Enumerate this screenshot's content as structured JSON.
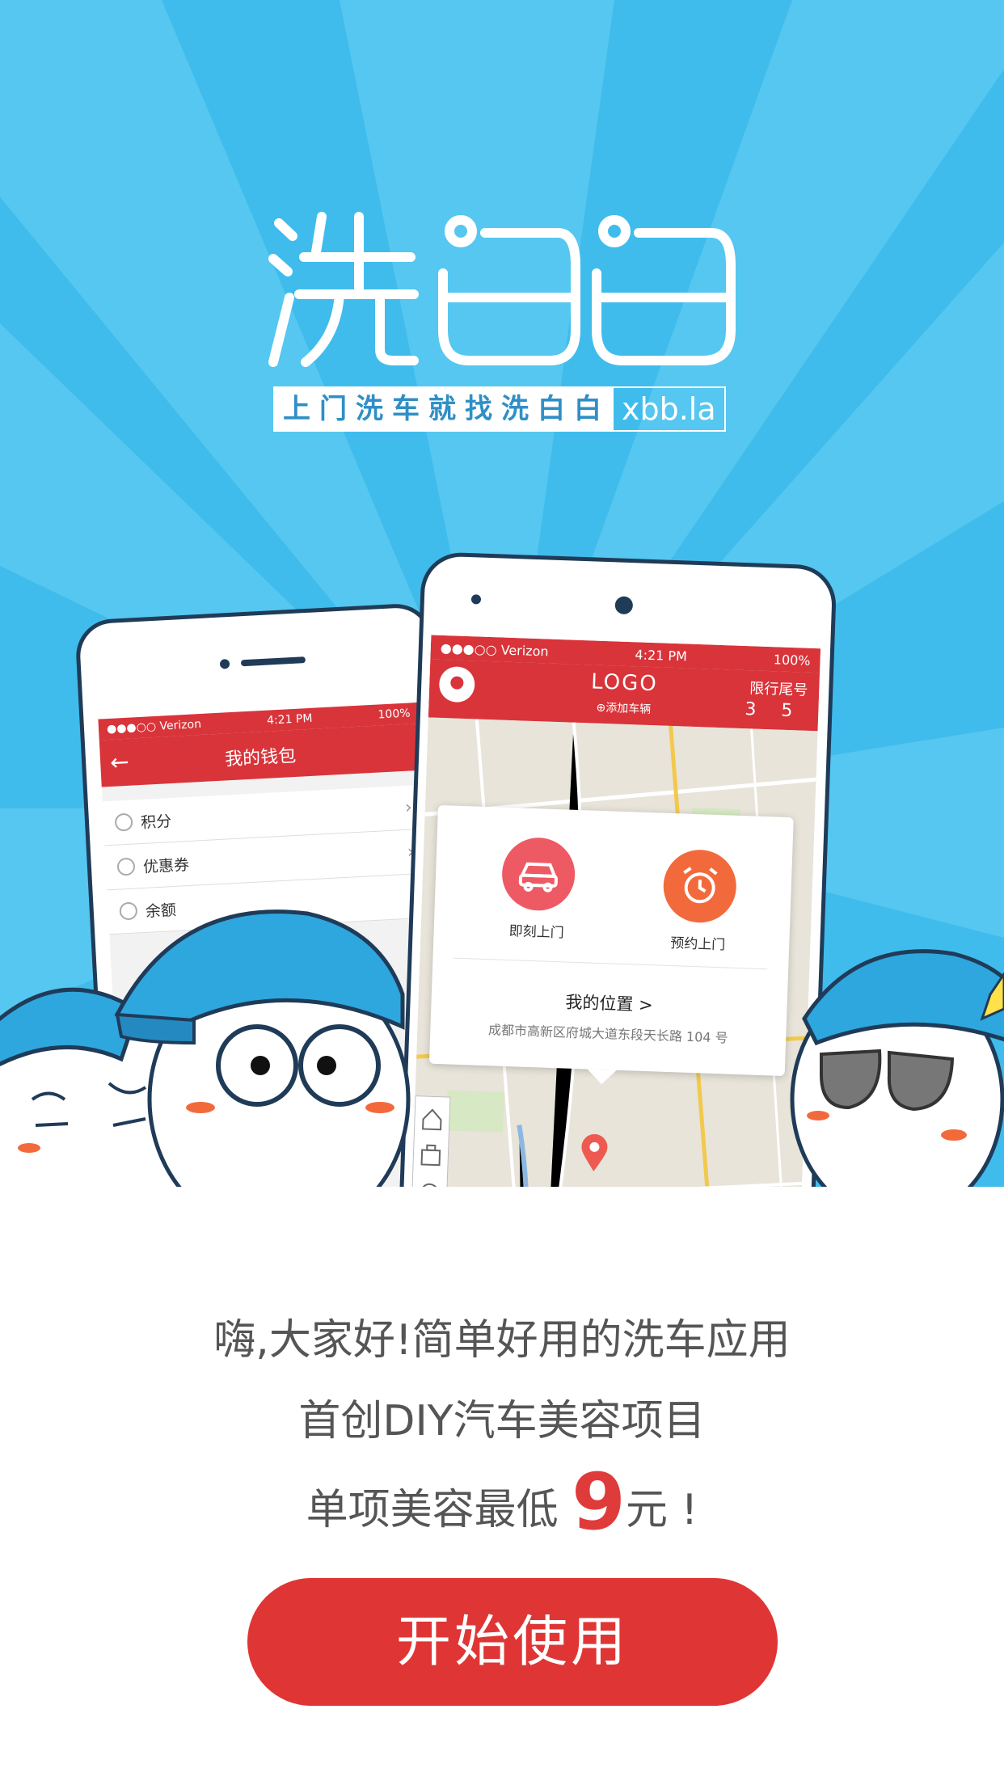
{
  "brand": {
    "logo_text": "洗白白",
    "tagline": "上门洗车就找洗白白",
    "url": "xbb.la"
  },
  "wallet_phone": {
    "carrier": "●●●○○ Verizon",
    "time": "4:21 PM",
    "battery": "100%",
    "title": "我的钱包",
    "rows": [
      {
        "label": "积分"
      },
      {
        "label": "优惠券"
      },
      {
        "label": "余额"
      }
    ]
  },
  "map_phone": {
    "carrier": "●●●○○ Verizon",
    "time": "4:21 PM",
    "battery": "100%",
    "logo": "LOGO",
    "add_car": "⊕添加车辆",
    "limit_label": "限行尾号",
    "limit_numbers": "3 5",
    "now_label": "即刻上门",
    "book_label": "预约上门",
    "location_title": "我的位置  >",
    "address": "成都市高新区府城大道东段天长路 104 号"
  },
  "copy": {
    "line1": "嗨,大家好!简单好用的洗车应用",
    "line2": "首创DIY汽车美容项目",
    "line3_pre": "单项美容最低 ",
    "price": "9",
    "line3_post": "元 !"
  },
  "cta": {
    "label": "开始使用"
  },
  "colors": {
    "sky": "#3fbcec",
    "red": "#e03535",
    "navy": "#1f3b58"
  },
  "icons": [
    "car-icon",
    "alarm-clock-icon",
    "location-pin-icon",
    "home-icon",
    "briefcase-icon",
    "locate-icon",
    "back-arrow-icon",
    "star-icon"
  ]
}
